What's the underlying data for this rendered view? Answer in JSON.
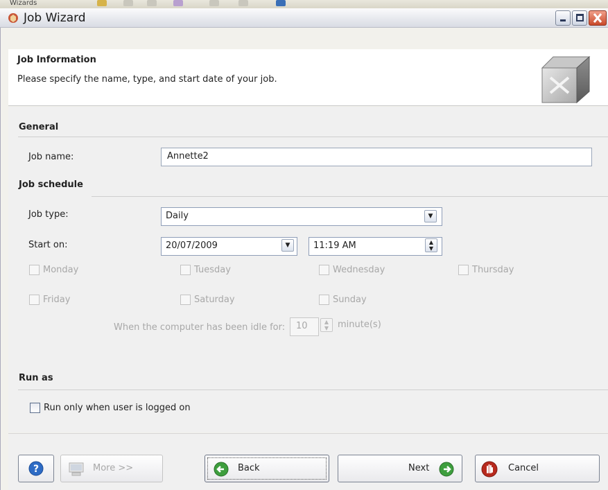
{
  "background_app": {
    "toolbar_label": "Wizards"
  },
  "window": {
    "title": "Job Wizard",
    "icon": "wizard-cube-icon"
  },
  "header": {
    "title": "Job Information",
    "description": "Please specify the name, type, and start date of your job.",
    "image": "job-cube-icon"
  },
  "general": {
    "section_title": "General",
    "job_name_label": "Job name:",
    "job_name_value": "Annette2"
  },
  "schedule": {
    "section_title": "Job schedule",
    "job_type_label": "Job type:",
    "job_type_value": "Daily",
    "start_on_label": "Start on:",
    "start_date": "20/07/2009",
    "start_time": "11:19 AM",
    "days": [
      "Monday",
      "Tuesday",
      "Wednesday",
      "Thursday",
      "Friday",
      "Saturday",
      "Sunday"
    ],
    "idle_label": "When the computer has been idle for:",
    "idle_value": "10",
    "idle_unit": "minute(s)"
  },
  "run_as": {
    "section_title": "Run as",
    "logged_on_label": "Run only when user is logged on"
  },
  "buttons": {
    "more": "More >>",
    "back": "Back",
    "next": "Next",
    "cancel": "Cancel"
  },
  "colors": {
    "accent_green": "#3e9e3e",
    "cancel_red": "#b82a1e",
    "help_blue": "#2d6bc5"
  }
}
